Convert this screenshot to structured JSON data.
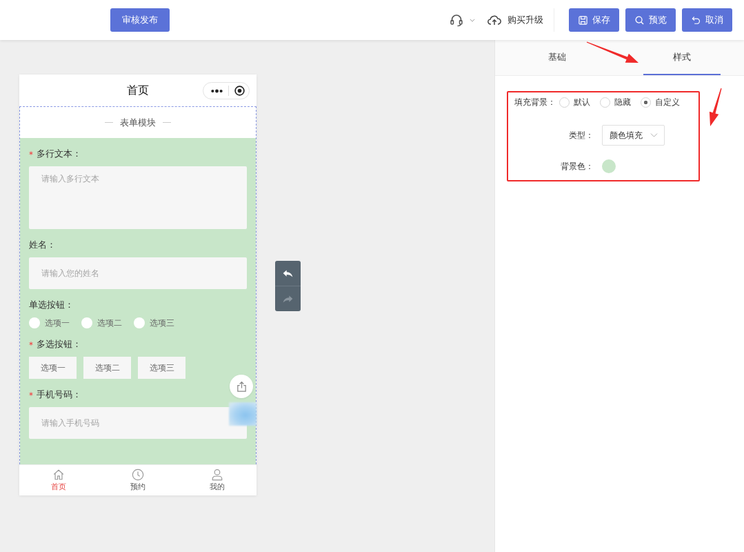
{
  "header": {
    "publish_button": "审核发布",
    "upgrade_link": "购买升级",
    "buttons": [
      "保存",
      "预览",
      "取消"
    ]
  },
  "phone": {
    "title": "首页",
    "module_title": "表单模块",
    "fields": [
      {
        "kind": "textarea",
        "label": "多行文本：",
        "required": true,
        "placeholder": "请输入多行文本"
      },
      {
        "kind": "input",
        "label": "姓名：",
        "required": false,
        "placeholder": "请输入您的姓名"
      },
      {
        "kind": "radio",
        "label": "单选按钮：",
        "required": false,
        "options": [
          {
            "label": "选项一",
            "selected": false
          },
          {
            "label": "选项二",
            "selected": false
          },
          {
            "label": "选项三",
            "selected": false
          }
        ]
      },
      {
        "kind": "checkbox",
        "label": "多选按钮：",
        "required": true,
        "options": [
          {
            "label": "选项一",
            "selected": false
          },
          {
            "label": "选项二",
            "selected": false
          },
          {
            "label": "选项三",
            "selected": false
          }
        ]
      },
      {
        "kind": "input",
        "label": "手机号码：",
        "required": true,
        "placeholder": "请输入手机号码"
      }
    ],
    "tab_bar": [
      {
        "label": "首页",
        "selected": true
      },
      {
        "label": "预约",
        "selected": false
      },
      {
        "label": "我的",
        "selected": false
      }
    ]
  },
  "history": [
    {
      "kind": "undo",
      "disabled": false
    },
    {
      "kind": "redo",
      "disabled": true
    }
  ],
  "settings": {
    "tabs": [
      {
        "label": "基础",
        "selected": false
      },
      {
        "label": "样式",
        "selected": true
      }
    ],
    "fill_background": {
      "label": "填充背景：",
      "options": [
        {
          "label": "默认",
          "selected": false
        },
        {
          "label": "隐藏",
          "selected": false
        },
        {
          "label": "自定义",
          "selected": true
        }
      ]
    },
    "type": {
      "label": "类型：",
      "value": "颜色填充"
    },
    "background_color": {
      "label": "背景色：",
      "color": "#c8e6c9"
    }
  }
}
